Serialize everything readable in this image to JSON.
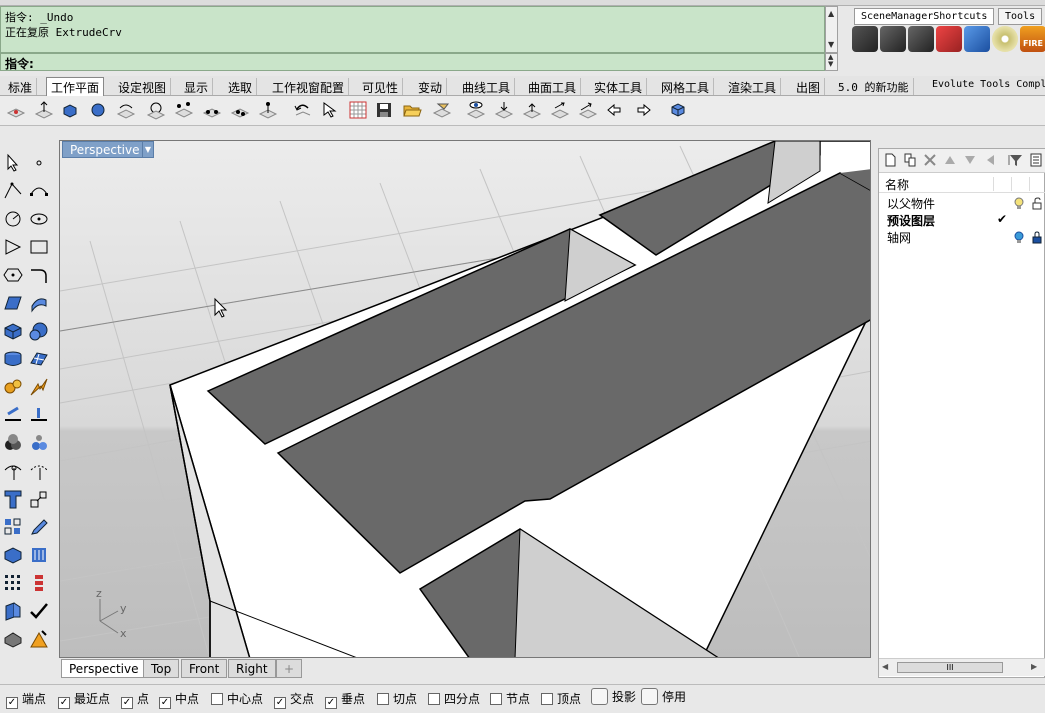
{
  "command": {
    "history": [
      "指令: _Undo",
      "正在复原 ExtrudeCrv"
    ],
    "prompt": "指令:"
  },
  "right_tabs": [
    "SceneManagerShortcuts",
    "Tools"
  ],
  "right_tool_icons": [
    "scene-manager-1-icon",
    "scene-manager-2-icon",
    "scene-manager-3-icon",
    "scene-manager-4-icon",
    "scene-manager-5-icon",
    "disc-icon",
    "fire-icon"
  ],
  "fire_label": "FIRE",
  "toolbar_tabs": [
    "标准",
    "工作平面",
    "设定视图",
    "显示",
    "选取",
    "工作视窗配置",
    "可见性",
    "变动",
    "曲线工具",
    "曲面工具",
    "实体工具",
    "网格工具",
    "渲染工具",
    "出图",
    "5.0 的新功能",
    "Evolute Tools Compl"
  ],
  "active_tab": "工作平面",
  "viewport": {
    "label": "Perspective",
    "axis_labels": {
      "z": "z",
      "y": "y",
      "x": "x"
    }
  },
  "viewport_tabs": [
    "Perspective",
    "Top",
    "Front",
    "Right"
  ],
  "add_tab": "+",
  "layers": {
    "header": "名称",
    "rows": [
      {
        "name": "以父物件",
        "bold": false
      },
      {
        "name": "预设图层",
        "bold": true
      },
      {
        "name": "轴网",
        "bold": false
      }
    ],
    "current_mark": "✔",
    "scroll_grip": "III"
  },
  "snaps": [
    {
      "label": "端点",
      "checked": true
    },
    {
      "label": "最近点",
      "checked": true
    },
    {
      "label": "点",
      "checked": true
    },
    {
      "label": "中点",
      "checked": true
    },
    {
      "label": "中心点",
      "checked": false
    },
    {
      "label": "交点",
      "checked": true
    },
    {
      "label": "垂点",
      "checked": true
    },
    {
      "label": "切点",
      "checked": false
    },
    {
      "label": "四分点",
      "checked": false
    },
    {
      "label": "节点",
      "checked": false
    },
    {
      "label": "顶点",
      "checked": false
    }
  ],
  "toggles": [
    "投影",
    "停用"
  ],
  "colors": {
    "command_bg": "#c9e4c9",
    "viewport_label_bg": "#7fa0c8"
  }
}
